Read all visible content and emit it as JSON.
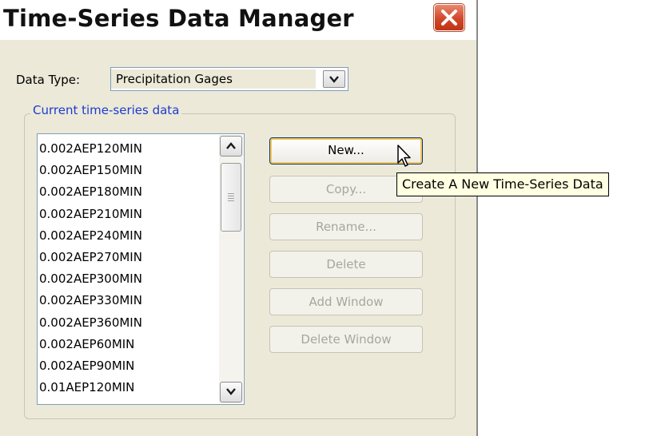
{
  "window": {
    "title": "Time-Series Data Manager"
  },
  "data_type": {
    "label": "Data Type:",
    "selected": "Precipitation Gages"
  },
  "group": {
    "legend": "Current time-series data"
  },
  "list_items": [
    "0.002AEP120MIN",
    "0.002AEP150MIN",
    "0.002AEP180MIN",
    "0.002AEP210MIN",
    "0.002AEP240MIN",
    "0.002AEP270MIN",
    "0.002AEP300MIN",
    "0.002AEP330MIN",
    "0.002AEP360MIN",
    "0.002AEP60MIN",
    "0.002AEP90MIN",
    "0.01AEP120MIN"
  ],
  "buttons": {
    "new": "New...",
    "copy": "Copy...",
    "rename": "Rename...",
    "delete": "Delete",
    "add_window": "Add Window",
    "delete_window": "Delete Window"
  },
  "tooltip": "Create A New Time-Series Data",
  "icons": [
    "close-icon",
    "chevron-down-icon",
    "chevron-up-icon",
    "scrollbar-grip-icon",
    "mouse-pointer-icon"
  ],
  "colors": {
    "legend_text": "#1b3bd1",
    "close_button": "#d2472a",
    "tooltip_bg": "#ffffe1",
    "dialog_bg": "#ece9d8"
  }
}
